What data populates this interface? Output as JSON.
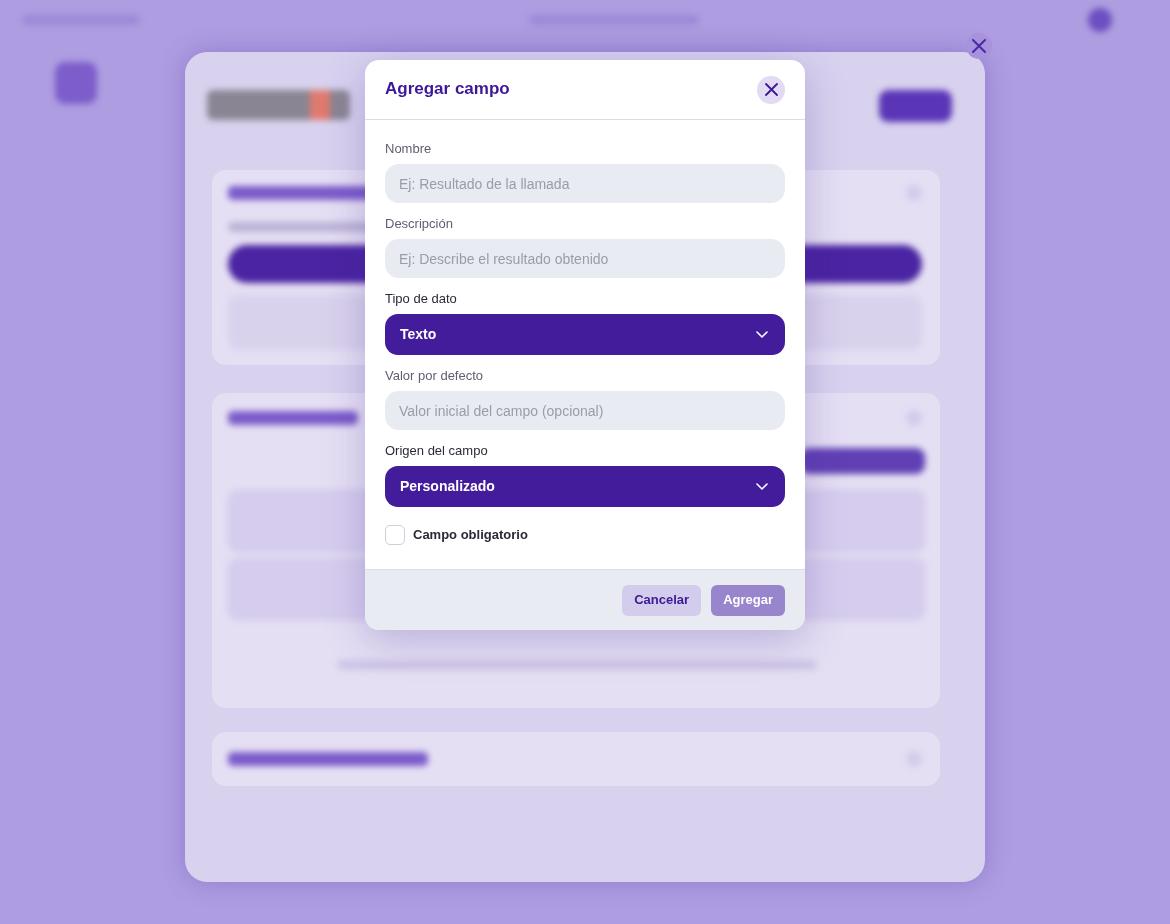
{
  "modal": {
    "title": "Agregar campo",
    "fields": [
      {
        "kind": "text",
        "label": "Nombre",
        "placeholder": "Ej: Resultado de la llamada"
      },
      {
        "kind": "text",
        "label": "Descripción",
        "placeholder": "Ej: Describe el resultado obtenido"
      },
      {
        "kind": "select",
        "label": "Tipo de dato",
        "value": "Texto"
      },
      {
        "kind": "text",
        "label": "Valor por defecto",
        "placeholder": "Valor inicial del campo (opcional)"
      },
      {
        "kind": "select",
        "label": "Origen del campo",
        "value": "Personalizado"
      }
    ],
    "checkbox": {
      "label": "Campo obligatorio",
      "checked": false
    },
    "buttons": [
      {
        "kind": "secondary",
        "label": "Cancelar",
        "disabled": false
      },
      {
        "kind": "primary",
        "label": "Agregar",
        "disabled": true
      }
    ]
  }
}
